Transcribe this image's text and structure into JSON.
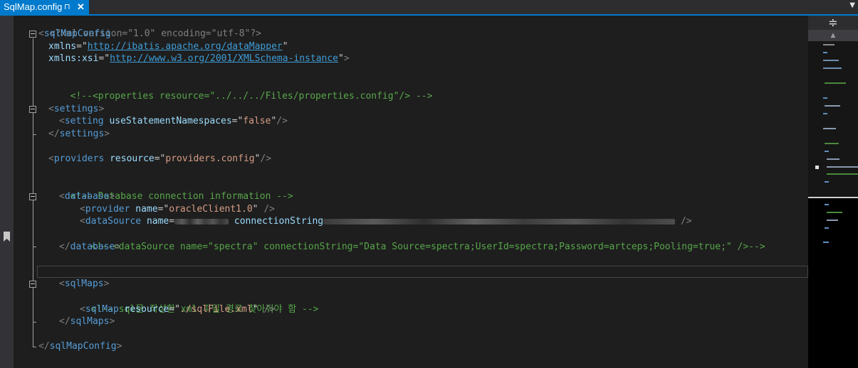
{
  "tab": {
    "title": "SqlMap.config",
    "pin_icon": "pin-icon",
    "close_icon": "close-icon"
  },
  "toolbar": {
    "dropdown_icon": "chevron-down-icon",
    "split_icon": "split-icon"
  },
  "code": {
    "l1_decl": "<?xml version=\"1.0\" encoding=\"utf-8\"?>",
    "l2_tag": "sqlMapConfig",
    "l3_attr": "xmlns",
    "l3_val": "http://ibatis.apache.org/dataMapper",
    "l4_attr": "xmlns:xsi",
    "l4_val": "http://www.w3.org/2001/XMLSchema-instance",
    "l6_comment": "<!--<properties resource=\"../../../Files/properties.config\"/> -->",
    "l8_tag": "settings",
    "l9_tag": "setting",
    "l9_attr": "useStatementNamespaces",
    "l9_val": "false",
    "l10_tag": "settings",
    "l12_tag": "providers",
    "l12_attr": "resource",
    "l12_val": "providers.config",
    "l14_comment": "<!-- Database connection information -->",
    "l15_tag": "database",
    "l16_tag": "provider",
    "l16_attr": "name",
    "l16_val": "oracleClient1.0",
    "l17_tag": "dataSource",
    "l17_attr1": "name",
    "l17_attr2": "connectionString",
    "l18_comment": "<!--<dataSource name=\"spectra\" connectionString=\"Data Source=spectra;UserId=spectra;Password=artceps;Pooling=true;\" />-->",
    "l19_tag": "database",
    "l22_tag": "sqlMaps",
    "l23_comment": "<!-- sql문 작성한 xml 파일 경로 찾아줘야 함 -->",
    "l24_tag": "sqlMap",
    "l24_attr": "resource",
    "l24_val": "./sqlFile.xml",
    "l25_tag": "sqlMaps",
    "l27_tag": "sqlMapConfig"
  },
  "colors": {
    "tab_active": "#007acc",
    "editor_bg": "#1e1e1e",
    "tag": "#569cd6",
    "attribute": "#9cdcfe",
    "value": "#d69d85",
    "comment": "#57a64a"
  }
}
